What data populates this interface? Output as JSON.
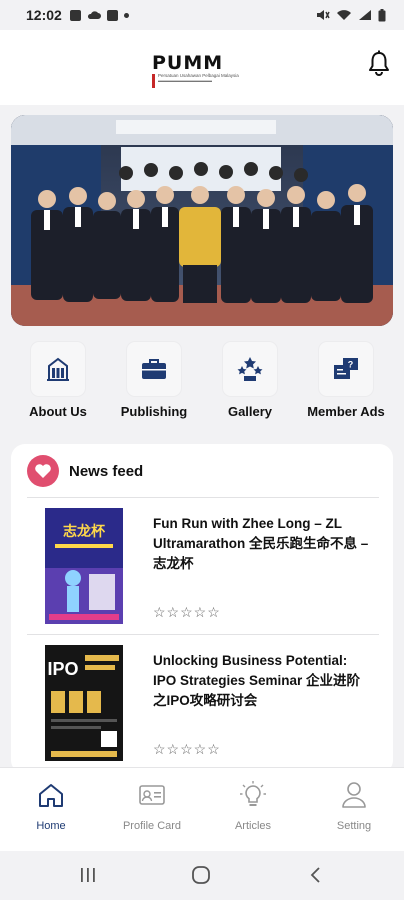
{
  "status_bar": {
    "time": "12:02",
    "left_icons": [
      "mail-icon",
      "cloud-icon",
      "facebook-icon",
      "dot-icon"
    ],
    "right_icons": [
      "mute-icon",
      "wifi-icon",
      "signal-icon",
      "battery-icon"
    ]
  },
  "header": {
    "logo_brand": "PUMM",
    "logo_tagline": "Persatuan Usahawan Pelbagai Malaysia",
    "bell_icon": "bell-icon"
  },
  "banner": {
    "image": "group-photo"
  },
  "menu": [
    {
      "label": "About Us",
      "icon": "building-icon"
    },
    {
      "label": "Publishing",
      "icon": "briefcase-icon"
    },
    {
      "label": "Gallery",
      "icon": "stars-icon"
    },
    {
      "label": "Member Ads",
      "icon": "ads-icon"
    }
  ],
  "news_feed": {
    "title": "News feed",
    "icon": "heart-icon",
    "items": [
      {
        "title": "Fun Run with Zhee Long – ZL Ultramarathon 全民乐跑生命不息 – 志龙杯",
        "rating": "☆☆☆☆☆",
        "poster_text": "志龙杯"
      },
      {
        "title": "Unlocking Business Potential: IPO Strategies Seminar 企业进阶之IPO攻略研讨会",
        "rating": "☆☆☆☆☆",
        "poster_text": "IPO"
      }
    ]
  },
  "tabs": [
    {
      "label": "Home",
      "icon": "home-icon",
      "active": true
    },
    {
      "label": "Profile Card",
      "icon": "id-card-icon",
      "active": false
    },
    {
      "label": "Articles",
      "icon": "lightbulb-icon",
      "active": false
    },
    {
      "label": "Setting",
      "icon": "user-icon",
      "active": false
    }
  ],
  "system_nav": [
    "recents-button",
    "home-button",
    "back-button"
  ],
  "colors": {
    "accent": "#1f3b73",
    "heart": "#e04e6f",
    "background": "#f2f2f4"
  }
}
